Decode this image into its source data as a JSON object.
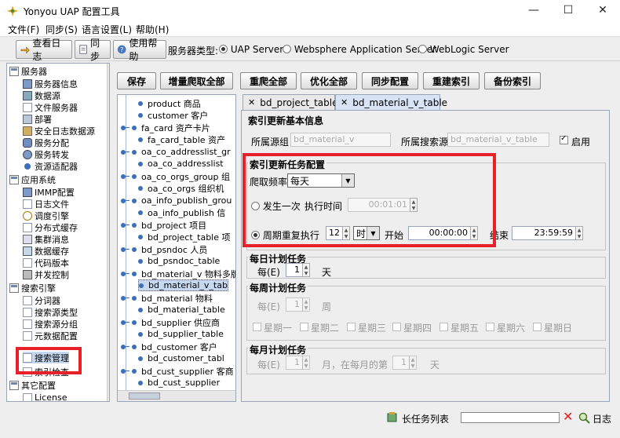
{
  "window": {
    "title": "Yonyou UAP 配置工具",
    "minimize": "—",
    "maximize": "☐",
    "close": "✕"
  },
  "menu": [
    "文件(F)",
    "同步(S)",
    "语言设置(L)",
    "帮助(H)"
  ],
  "toolbar": {
    "log_button": "查看日志",
    "sync_button": "同步",
    "help_button": "使用帮助",
    "server_type_label": "服务器类型:",
    "server_options": [
      "UAP Server",
      "Websphere Application Server",
      "WebLogic Server"
    ],
    "server_selected": "UAP Server"
  },
  "left_tree": {
    "groups": [
      {
        "label": "服务器",
        "items": [
          "服务器信息",
          "数据源",
          "文件服务器",
          "部署",
          "安全日志数据源",
          "服务分配",
          "服务转发",
          "资源适配器"
        ]
      },
      {
        "label": "应用系统",
        "items": [
          "IMMP配置",
          "日志文件",
          "调度引擎",
          "分布式缓存",
          "集群消息",
          "数据缓存",
          "代码版本",
          "并发控制"
        ]
      },
      {
        "label": "搜索引擎",
        "items": [
          "分词器",
          "搜索源类型",
          "搜索源分组",
          "元数据配置",
          "搜索管理",
          "索引检查"
        ]
      },
      {
        "label": "其它配置",
        "items": [
          "License"
        ]
      }
    ],
    "selected": "搜索管理"
  },
  "actions": [
    "保存",
    "增量爬取全部",
    "重爬全部",
    "优化全部",
    "同步配置",
    "重建索引",
    "备份索引"
  ],
  "mid_tree": [
    {
      "label": "product 商品",
      "level": 1
    },
    {
      "label": "customer 客户",
      "level": 1
    },
    {
      "label": "fa_card 资产卡片",
      "level": 0
    },
    {
      "label": "fa_card_table 资产",
      "level": 1
    },
    {
      "label": "oa_co_addresslist_gr",
      "level": 0
    },
    {
      "label": "oa_co_addresslist",
      "level": 1
    },
    {
      "label": "oa_co_orgs_group 组",
      "level": 0
    },
    {
      "label": "oa_co_orgs 组织机",
      "level": 1
    },
    {
      "label": "oa_info_publish_grou",
      "level": 0
    },
    {
      "label": "oa_info_publish 信",
      "level": 1
    },
    {
      "label": "bd_project 项目",
      "level": 0
    },
    {
      "label": "bd_project_table 项",
      "level": 1
    },
    {
      "label": "bd_psndoc 人员",
      "level": 0
    },
    {
      "label": "bd_psndoc_table",
      "level": 1
    },
    {
      "label": "bd_material_v 物料多版",
      "level": 0
    },
    {
      "label": "bd_material_v_tab",
      "level": 1
    },
    {
      "label": "bd_material 物料",
      "level": 0
    },
    {
      "label": "bd_material_table",
      "level": 1
    },
    {
      "label": "bd_supplier 供应商",
      "level": 0
    },
    {
      "label": "bd_supplier_table",
      "level": 1
    },
    {
      "label": "bd_customer 客户",
      "level": 0
    },
    {
      "label": "bd_customer_tabl",
      "level": 1
    },
    {
      "label": "bd_cust_supplier 客商",
      "level": 0
    },
    {
      "label": "bd_cust_supplier",
      "level": 1
    }
  ],
  "mid_selected_index": 15,
  "tabs": [
    "bd_project_table",
    "bd_material_v_table"
  ],
  "tab_selected": "bd_material_v_table",
  "basic": {
    "title": "索引更新基本信息",
    "group_label": "所属源组",
    "group_value": "bd_material_v",
    "source_label": "所属搜索源",
    "source_value": "bd_material_v_table",
    "enable_label": "启用",
    "enabled": true
  },
  "task": {
    "title": "索引更新任务配置",
    "freq_label": "爬取频率",
    "freq_value": "每天",
    "once_label": "发生一次",
    "exec_time_label": "执行时间",
    "exec_time_value": "00:01:01",
    "periodic_label": "周期重复执行",
    "period_value": "12",
    "period_unit": "时",
    "start_label": "开始",
    "start_value": "00:00:00",
    "end_label": "结束",
    "end_value": "23:59:59",
    "selected": "周期重复执行"
  },
  "daily": {
    "title": "每日计划任务",
    "every_label": "每(E)",
    "every_value": "1",
    "unit": "天"
  },
  "weekly": {
    "title": "每周计划任务",
    "every_label": "每(E)",
    "every_value": "1",
    "unit": "周",
    "days": [
      "星期一",
      "星期二",
      "星期三",
      "星期四",
      "星期五",
      "星期六",
      "星期日"
    ]
  },
  "monthly": {
    "title": "每月计划任务",
    "every_label": "每(E)",
    "every_value": "1",
    "month_text": "月，在每月的第",
    "day_value": "1",
    "unit": "天"
  },
  "statusbar": {
    "long_task_label": "长任务列表",
    "log_label": "日志"
  },
  "colors": {
    "highlight_red": "#e8202a",
    "selection_blue": "#c6d8f0",
    "tree_dot": "#3b6fb6"
  }
}
